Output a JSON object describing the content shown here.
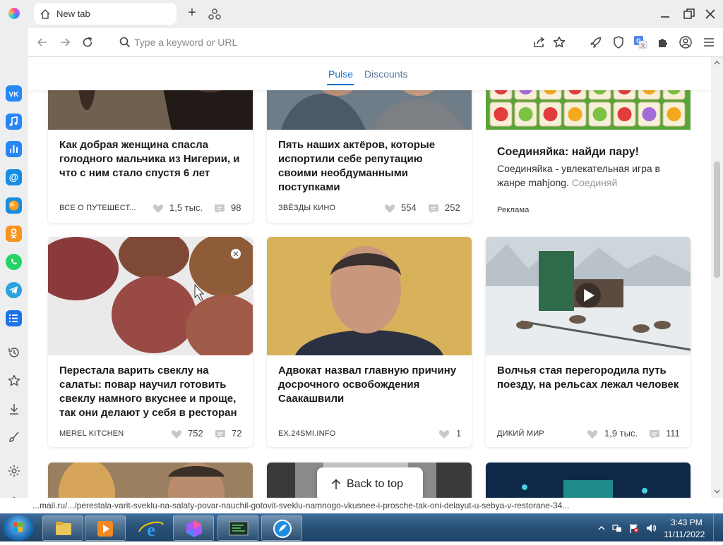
{
  "browser": {
    "tab_title": "New tab",
    "url_placeholder": "Type a keyword or URL"
  },
  "feed": {
    "tabs": [
      "Pulse",
      "Discounts"
    ],
    "active_tab": "Pulse",
    "back_to_top": "Back to top",
    "cards": [
      {
        "title": "Как добрая женщина спасла голодного мальчика из Нигерии, и что с ним стало спустя 6 лет",
        "source": "ВСЕ О ПУТЕШЕСТ...",
        "likes": "1,5 тыс.",
        "comments": "98"
      },
      {
        "title": "Пять наших актёров, которые испортили себе репутацию своими необдуманными поступками",
        "source": "ЗВЁЗДЫ КИНО",
        "likes": "554",
        "comments": "252"
      },
      {
        "title": "Соединяйка: найди пару!",
        "description": "Соединяйка - увлекательная игра в жанре mahjong.",
        "description_tail": "Соединяй",
        "source": "Реклама"
      },
      {
        "title": "Перестала варить свеклу на салаты: повар научил готовить свеклу намного вкуснее и проще, так они делают у себя в ресторан",
        "source": "MEREL KITCHEN",
        "likes": "752",
        "comments": "72"
      },
      {
        "title": "Адвокат назвал главную причину досрочного освобождения Саакашвили",
        "source": "EX.24SMI.INFO",
        "likes": "1"
      },
      {
        "title": "Волчья стая перегородила путь поезду, на рельсах лежал человек",
        "source": "ДИКИЙ МИР",
        "likes": "1,9 тыс.",
        "comments": "111"
      }
    ]
  },
  "status_url": "...mail.ru/.../perestala-varit-sveklu-na-salaty-povar-nauchil-gotovit-sveklu-namnogo-vkusnee-i-prosche-tak-oni-delayut-u-sebya-v-restorane-34...",
  "taskbar": {
    "time": "3:43 PM",
    "date": "11/11/2022"
  },
  "colors": {
    "accent": "#1a73c8",
    "taskbar": "#2a5278"
  }
}
